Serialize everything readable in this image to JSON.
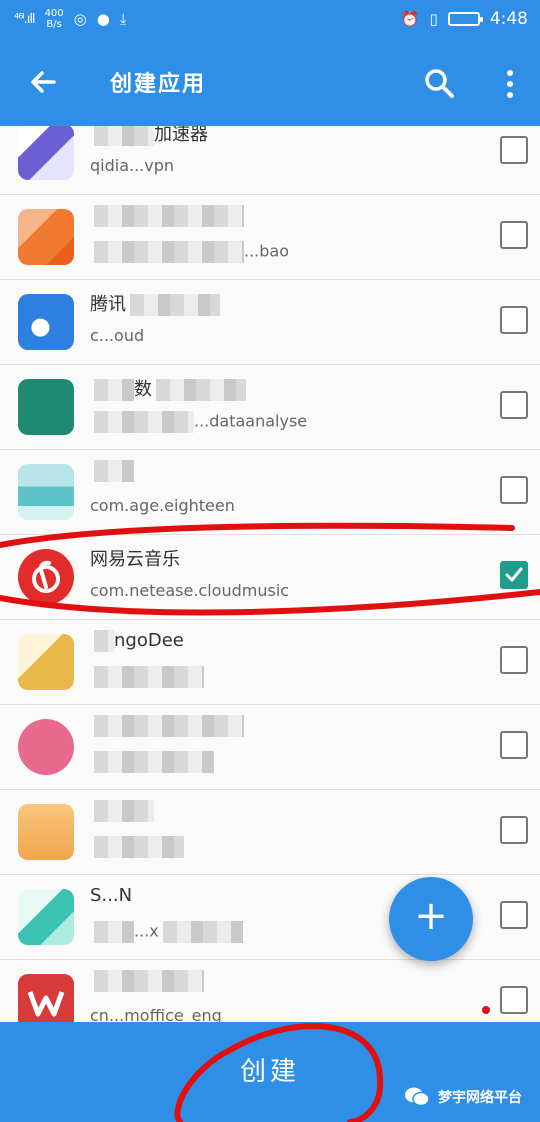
{
  "status": {
    "signal": "⁴⁶ˡ.ıll",
    "speed_value": "400",
    "speed_unit": "B/s",
    "time": "4:48"
  },
  "appbar": {
    "title": "创建应用"
  },
  "apps": [
    {
      "name": "加速器",
      "package": "qidia...vpn",
      "checked": false,
      "color": "#6b5fd3"
    },
    {
      "name": "",
      "package": "...bao",
      "checked": false,
      "color": "#f07a32"
    },
    {
      "name": "腾讯",
      "package": "c...oud",
      "checked": false,
      "color": "#2d7fe0"
    },
    {
      "name": "数",
      "package": "...dataanalyse",
      "checked": false,
      "color": "#1f8a73"
    },
    {
      "name": "",
      "package": "com.age.eighteen",
      "checked": false,
      "color": "#5fc2c8"
    },
    {
      "name": "网易云音乐",
      "package": "com.netease.cloudmusic",
      "checked": true,
      "color": "#e22b2b"
    },
    {
      "name": "ngoDee",
      "package": "",
      "checked": false,
      "color": "#e9b84a"
    },
    {
      "name": "",
      "package": "",
      "checked": false,
      "color": "#e86a8e"
    },
    {
      "name": "",
      "package": "",
      "checked": false,
      "color": "#f2a54a"
    },
    {
      "name": "S...N",
      "package": "...x",
      "checked": false,
      "color": "#3cc2b0"
    },
    {
      "name": "",
      "package": "cn...moffice_eng",
      "checked": false,
      "color": "#d83a3a"
    }
  ],
  "bottom": {
    "create_label": "创建",
    "watermark": "梦宇网络平台"
  }
}
